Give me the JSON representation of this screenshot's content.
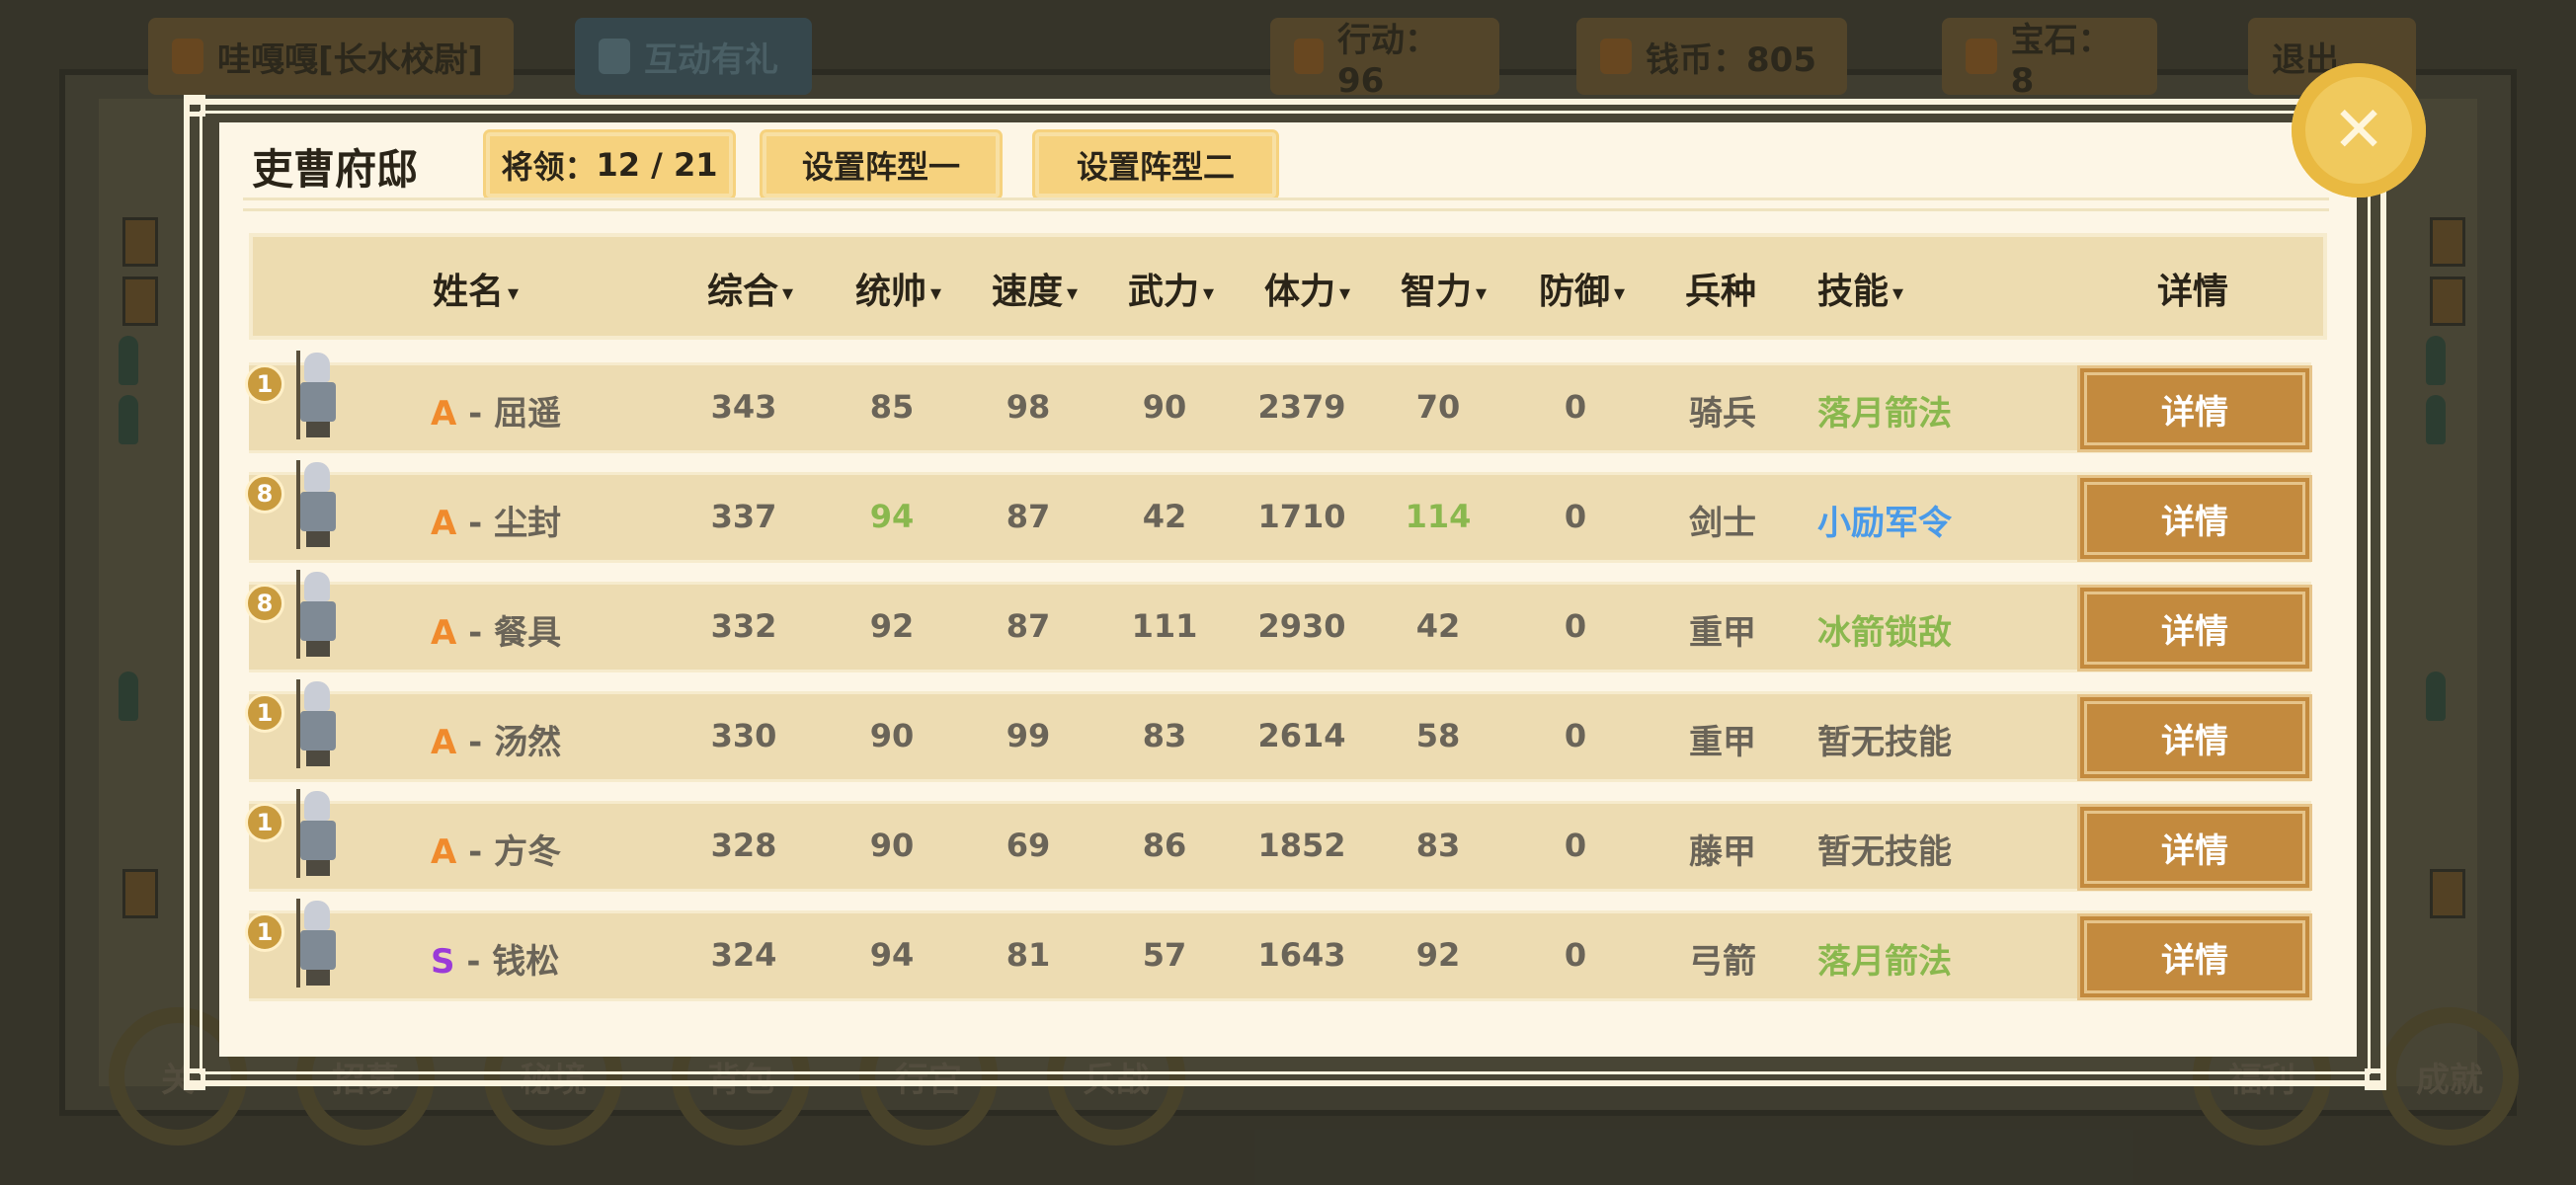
{
  "hud": {
    "player_name": "哇嘎嘎[长水校尉]",
    "gift_label": "互动有礼",
    "action_label": "行动：96",
    "coins_label": "钱币：805",
    "gems_label": "宝石：8",
    "exit_label": "退出"
  },
  "bottom_menu": [
    "关",
    "招募",
    "秘境",
    "背包",
    "行宫",
    "兵战",
    "福利",
    "成就"
  ],
  "modal": {
    "title": "吏曹府邸",
    "generals_label": "将领：",
    "generals_count": "12 / 21",
    "formation1_label": "设置阵型一",
    "formation2_label": "设置阵型二",
    "close_icon": "close-icon"
  },
  "table": {
    "headers": {
      "name": "姓名",
      "total": "综合",
      "command": "统帅",
      "speed": "速度",
      "force": "武力",
      "stamina": "体力",
      "intellect": "智力",
      "defense": "防御",
      "troop": "兵种",
      "skill": "技能",
      "detail": "详情"
    },
    "sort_icon": "chevron-down-icon",
    "rows": [
      {
        "level": "1",
        "grade": "A",
        "name": "屈遥",
        "total": "343",
        "command": "85",
        "speed": "98",
        "force": "90",
        "stamina": "2379",
        "intellect": "70",
        "defense": "0",
        "troop": "骑兵",
        "skill": "落月箭法",
        "skill_color": "#8ab84e",
        "detail": "详情"
      },
      {
        "level": "8",
        "grade": "A",
        "name": "尘封",
        "total": "337",
        "command": "94",
        "speed": "87",
        "force": "42",
        "stamina": "1710",
        "intellect": "114",
        "defense": "0",
        "troop": "剑士",
        "skill": "小励军令",
        "skill_color": "#4a9ae8",
        "detail": "详情"
      },
      {
        "level": "8",
        "grade": "A",
        "name": "餐具",
        "total": "332",
        "command": "92",
        "speed": "87",
        "force": "111",
        "stamina": "2930",
        "intellect": "42",
        "defense": "0",
        "troop": "重甲",
        "skill": "冰箭锁敌",
        "skill_color": "#8ab84e",
        "detail": "详情"
      },
      {
        "level": "1",
        "grade": "A",
        "name": "汤然",
        "total": "330",
        "command": "90",
        "speed": "99",
        "force": "83",
        "stamina": "2614",
        "intellect": "58",
        "defense": "0",
        "troop": "重甲",
        "skill": "暂无技能",
        "skill_color": "#6a6458",
        "detail": "详情"
      },
      {
        "level": "1",
        "grade": "A",
        "name": "方冬",
        "total": "328",
        "command": "90",
        "speed": "69",
        "force": "86",
        "stamina": "1852",
        "intellect": "83",
        "defense": "0",
        "troop": "藤甲",
        "skill": "暂无技能",
        "skill_color": "#6a6458",
        "detail": "详情"
      },
      {
        "level": "1",
        "grade": "S",
        "name": "钱松",
        "total": "324",
        "command": "94",
        "speed": "81",
        "force": "57",
        "stamina": "1643",
        "intellect": "92",
        "defense": "0",
        "troop": "弓箭",
        "skill": "落月箭法",
        "skill_color": "#8ab84e",
        "detail": "详情"
      }
    ]
  },
  "colors": {
    "grade_A": "#f08a2c",
    "grade_S": "#9b3ad8",
    "highlight_green": "#8ab84e",
    "detail_button": "#c38a3e"
  }
}
